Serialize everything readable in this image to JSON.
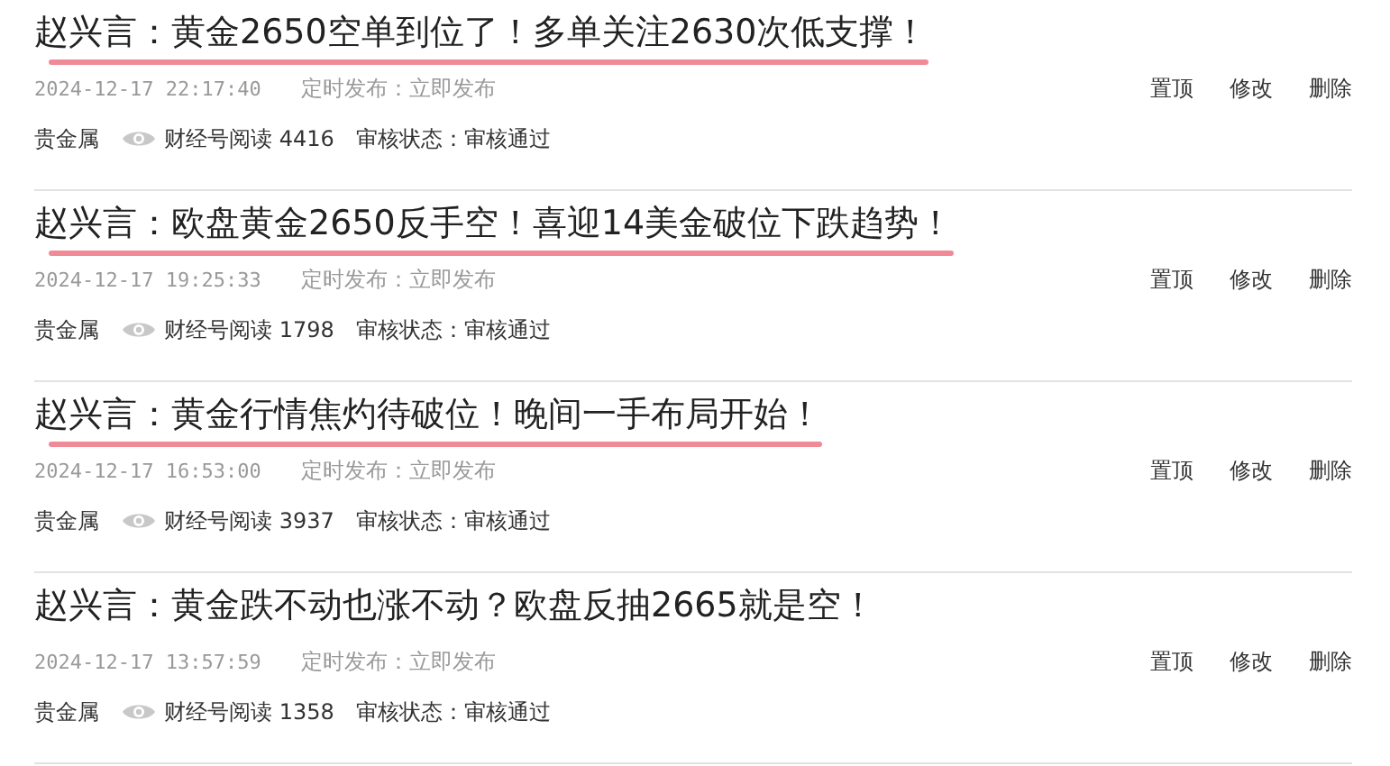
{
  "articles": [
    {
      "title": "赵兴言：黄金2650空单到位了！多单关注2630次低支撑！",
      "highlighted": true,
      "time": "2024-12-17 22:17:40",
      "schedule": "定时发布：立即发布",
      "category": "贵金属",
      "reads": "财经号阅读 4416",
      "review": "审核状态：审核通过",
      "actions": [
        "置顶",
        "修改",
        "删除"
      ]
    },
    {
      "title": "赵兴言：欧盘黄金2650反手空！喜迎14美金破位下跌趋势！",
      "highlighted": true,
      "time": "2024-12-17 19:25:33",
      "schedule": "定时发布：立即发布",
      "category": "贵金属",
      "reads": "财经号阅读 1798",
      "review": "审核状态：审核通过",
      "actions": [
        "置顶",
        "修改",
        "删除"
      ]
    },
    {
      "title": "赵兴言：黄金行情焦灼待破位！晚间一手布局开始！",
      "highlighted": true,
      "time": "2024-12-17 16:53:00",
      "schedule": "定时发布：立即发布",
      "category": "贵金属",
      "reads": "财经号阅读 3937",
      "review": "审核状态：审核通过",
      "actions": [
        "置顶",
        "修改",
        "删除"
      ]
    },
    {
      "title": "赵兴言：黄金跌不动也涨不动？欧盘反抽2665就是空！",
      "highlighted": false,
      "time": "2024-12-17 13:57:59",
      "schedule": "定时发布：立即发布",
      "category": "贵金属",
      "reads": "财经号阅读 1358",
      "review": "审核状态：审核通过",
      "actions": [
        "置顶",
        "修改",
        "删除"
      ]
    }
  ]
}
